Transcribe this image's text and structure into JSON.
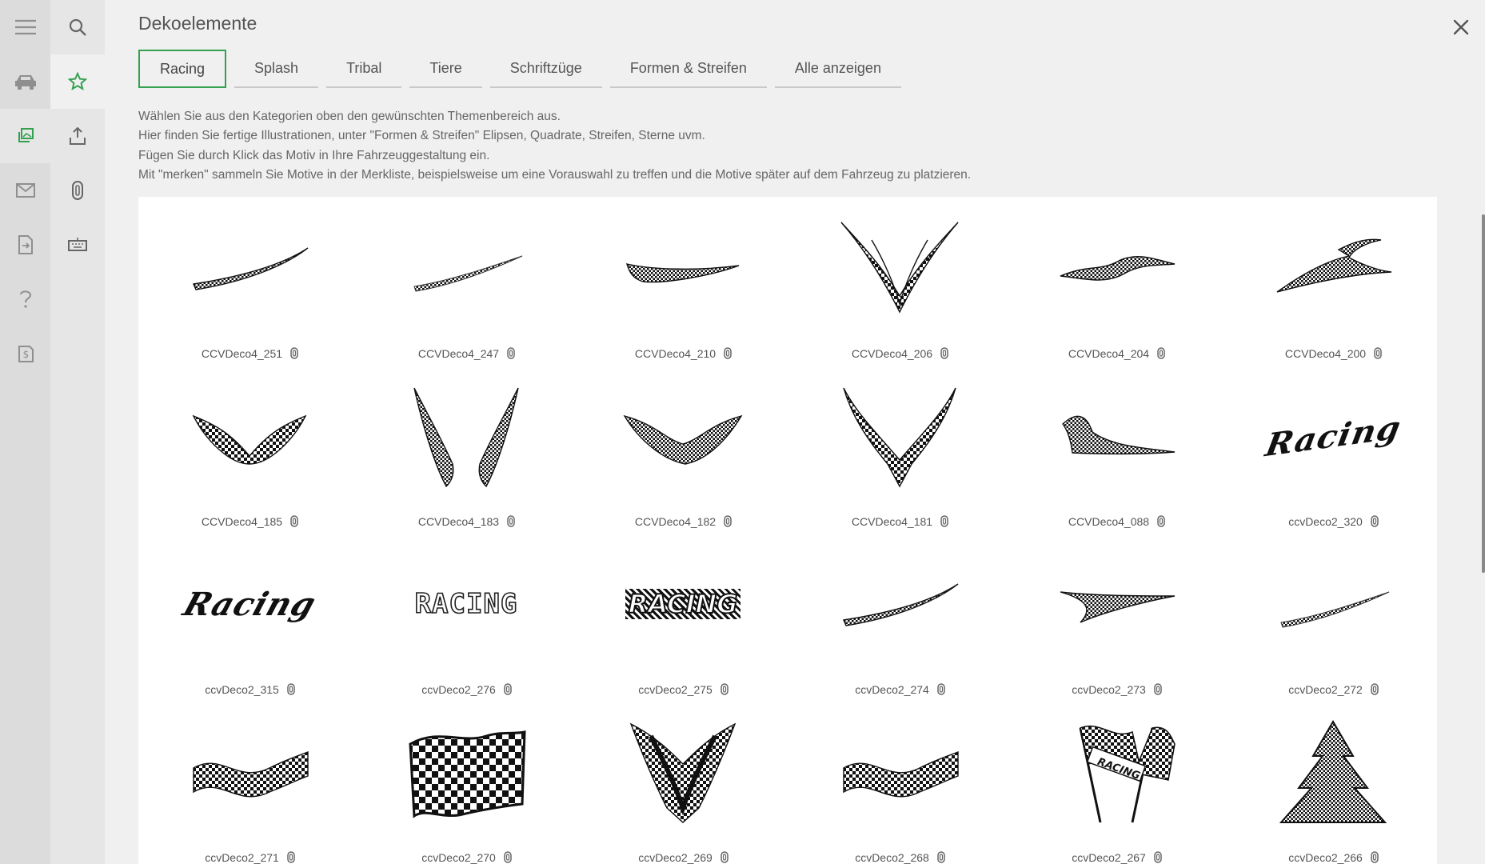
{
  "title": "Dekoelemente",
  "tabs": [
    {
      "label": "Racing",
      "active": true
    },
    {
      "label": "Splash"
    },
    {
      "label": "Tribal"
    },
    {
      "label": "Tiere"
    },
    {
      "label": "Schriftzüge"
    },
    {
      "label": "Formen & Streifen"
    },
    {
      "label": "Alle anzeigen"
    }
  ],
  "description": [
    "Wählen Sie aus den Kategorien oben den gewünschten Themenbereich aus.",
    "Hier finden Sie fertige Illustrationen, unter \"Formen & Streifen\" Elipsen, Quadrate, Streifen, Sterne uvm.",
    "Fügen Sie durch Klick das Motiv in Ihre Fahrzeuggestaltung ein.",
    "Mit \"merken\" sammeln Sie Motive in der Merkliste, beispielsweise um eine Vorauswahl zu treffen und die Motive später auf dem Fahrzeug zu platzieren."
  ],
  "rail_primary": [
    "menu-icon",
    "car-icon",
    "gallery-icon",
    "mail-icon",
    "document-icon",
    "help-icon",
    "price-icon"
  ],
  "rail_secondary": [
    "search-icon",
    "star-icon",
    "upload-icon",
    "clip-icon",
    "keyboard-icon"
  ],
  "accent_color": "#33a14f",
  "items": [
    {
      "name": "CCVDeco4_251",
      "shape": "swoosh-up"
    },
    {
      "name": "CCVDeco4_247",
      "shape": "swoosh-thin"
    },
    {
      "name": "CCVDeco4_210",
      "shape": "band"
    },
    {
      "name": "CCVDeco4_206",
      "shape": "v-big"
    },
    {
      "name": "CCVDeco4_204",
      "shape": "wave-small"
    },
    {
      "name": "CCVDeco4_200",
      "shape": "swoosh-hook"
    },
    {
      "name": "CCVDeco4_185",
      "shape": "wings"
    },
    {
      "name": "CCVDeco4_183",
      "shape": "v-spikes"
    },
    {
      "name": "CCVDeco4_182",
      "shape": "wings-curve"
    },
    {
      "name": "CCVDeco4_181",
      "shape": "v-flames"
    },
    {
      "name": "CCVDeco4_088",
      "shape": "fin"
    },
    {
      "name": "ccvDeco2_320",
      "shape": "text-script",
      "text": "Racing"
    },
    {
      "name": "ccvDeco2_315",
      "shape": "text-script",
      "text": "Racing"
    },
    {
      "name": "ccvDeco2_276",
      "shape": "text-block",
      "text": "RACING"
    },
    {
      "name": "ccvDeco2_275",
      "shape": "text-check",
      "text": "RACING"
    },
    {
      "name": "ccvDeco2_274",
      "shape": "swoosh-up"
    },
    {
      "name": "ccvDeco2_273",
      "shape": "swoosh-down"
    },
    {
      "name": "ccvDeco2_272",
      "shape": "swoosh-thin"
    },
    {
      "name": "ccvDeco2_271",
      "shape": "wave-band"
    },
    {
      "name": "ccvDeco2_270",
      "shape": "flag"
    },
    {
      "name": "ccvDeco2_269",
      "shape": "v-tribal"
    },
    {
      "name": "ccvDeco2_268",
      "shape": "wave-band"
    },
    {
      "name": "ccvDeco2_267",
      "shape": "flags-cross",
      "text": "RACING"
    },
    {
      "name": "ccvDeco2_266",
      "shape": "tree"
    }
  ]
}
